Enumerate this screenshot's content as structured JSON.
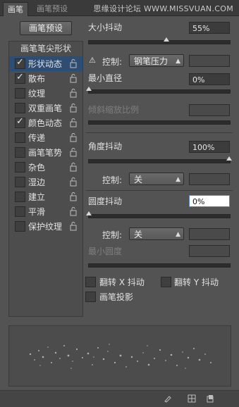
{
  "tabs": [
    {
      "label": "画笔",
      "active": true
    },
    {
      "label": "画笔预设",
      "active": false
    }
  ],
  "watermark": "思缘设计论坛 WWW.MISSVUAN.COM",
  "preset_button": "画笔预设",
  "list": {
    "header": "画笔笔尖形状",
    "items": [
      {
        "label": "形状动态",
        "checked": true,
        "selected": true
      },
      {
        "label": "散布",
        "checked": true,
        "selected": false
      },
      {
        "label": "纹理",
        "checked": false,
        "selected": false
      },
      {
        "label": "双重画笔",
        "checked": false,
        "selected": false
      },
      {
        "label": "颜色动态",
        "checked": true,
        "selected": false
      },
      {
        "label": "传递",
        "checked": false,
        "selected": false
      },
      {
        "label": "画笔笔势",
        "checked": false,
        "selected": false
      },
      {
        "label": "杂色",
        "checked": false,
        "selected": false
      },
      {
        "label": "湿边",
        "checked": false,
        "selected": false
      },
      {
        "label": "建立",
        "checked": false,
        "selected": false
      },
      {
        "label": "平滑",
        "checked": false,
        "selected": false
      },
      {
        "label": "保护纹理",
        "checked": false,
        "selected": false
      }
    ]
  },
  "size_jitter": {
    "label": "大小抖动",
    "value": "55%",
    "level": 0.55
  },
  "control_1": {
    "label": "控制:",
    "value": "钢笔压力",
    "warning": "⚠"
  },
  "min_diameter": {
    "label": "最小直径",
    "value": "0%",
    "level": 0
  },
  "tilt_scale": {
    "label": "倾斜缩放比例"
  },
  "angle_jitter": {
    "label": "角度抖动",
    "value": "100%",
    "level": 1.0
  },
  "control_2": {
    "label": "控制:",
    "value": "关"
  },
  "roundness_jitter": {
    "label": "圆度抖动",
    "value": "0%",
    "level": 0
  },
  "control_3": {
    "label": "控制:",
    "value": "关"
  },
  "min_roundness": {
    "label": "最小圆度"
  },
  "flip_x": {
    "label": "翻转 X 抖动",
    "checked": false
  },
  "flip_y": {
    "label": "翻转 Y 抖动",
    "checked": false
  },
  "brush_projection": {
    "label": "画笔投影",
    "checked": false
  },
  "icons": {
    "warning": "warning-icon",
    "lock": "lock-icon",
    "brush": "brush-icon",
    "grid": "grid-icon",
    "new": "new-preset-icon"
  }
}
